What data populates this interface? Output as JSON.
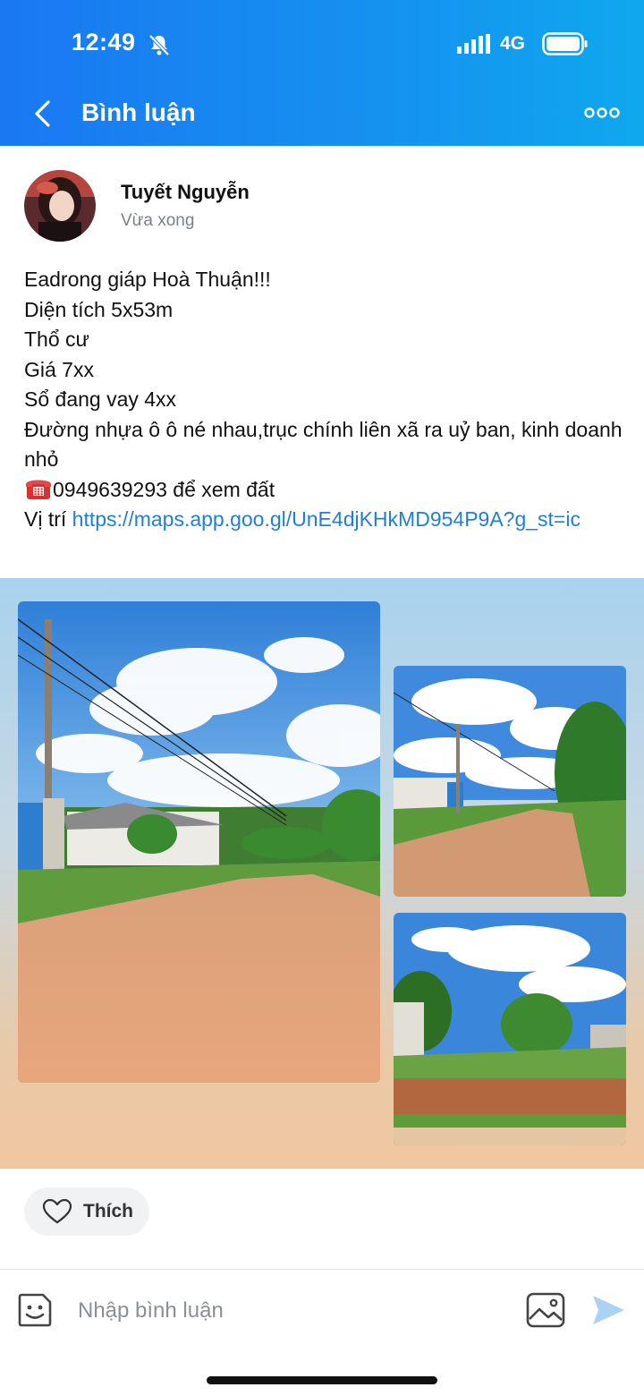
{
  "status_bar": {
    "time": "12:49",
    "network": "4G"
  },
  "header": {
    "title": "Bình luận"
  },
  "post": {
    "author": "Tuyết Nguyễn",
    "time": "Vừa xong",
    "lines": [
      "Eadrong giáp Hoà Thuận!!!",
      "Diện tích 5x53m",
      "Thổ cư",
      "Giá 7xx",
      "Sổ đang vay 4xx",
      "Đường nhựa ô ô né nhau,trục chính liên xã ra uỷ ban, kinh doanh nhỏ"
    ],
    "phone_line": "0949639293 để xem đất",
    "location_prefix": "Vị trí ",
    "location_link": "https://maps.app.goo.gl/UnE4djKHkMD954P9A?g_st=ic"
  },
  "actions": {
    "like_label": "Thích"
  },
  "comment": {
    "placeholder": "Nhập bình luận"
  },
  "colors": {
    "header_start": "#1a78f2",
    "header_end": "#0fa8ee",
    "link": "#1f7fd6"
  }
}
